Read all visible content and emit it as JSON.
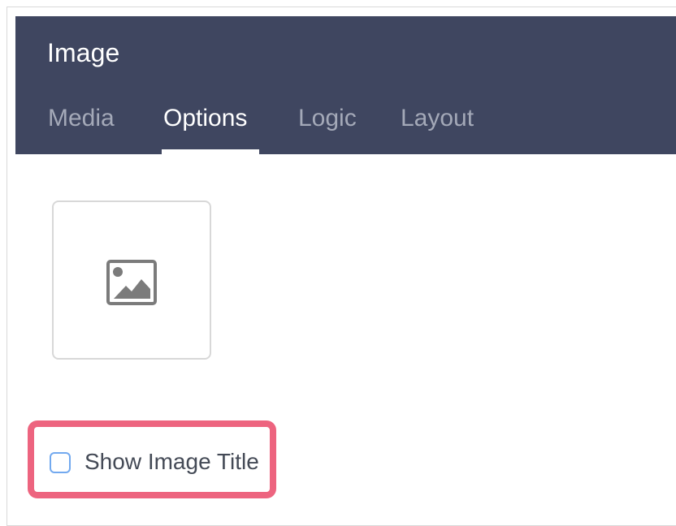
{
  "header": {
    "title": "Image",
    "tabs": [
      {
        "label": "Media",
        "active": false
      },
      {
        "label": "Options",
        "active": true
      },
      {
        "label": "Logic",
        "active": false
      },
      {
        "label": "Layout",
        "active": false
      }
    ]
  },
  "content": {
    "image_tile_icon": "image-placeholder-icon",
    "show_image_title": {
      "label": "Show Image Title",
      "checked": false
    }
  },
  "colors": {
    "header_background": "#3f4660",
    "active_tab": "#ffffff",
    "inactive_tab": "#a4a9b8",
    "highlight_border": "#ed647f",
    "checkbox_border": "#72a9ef"
  }
}
